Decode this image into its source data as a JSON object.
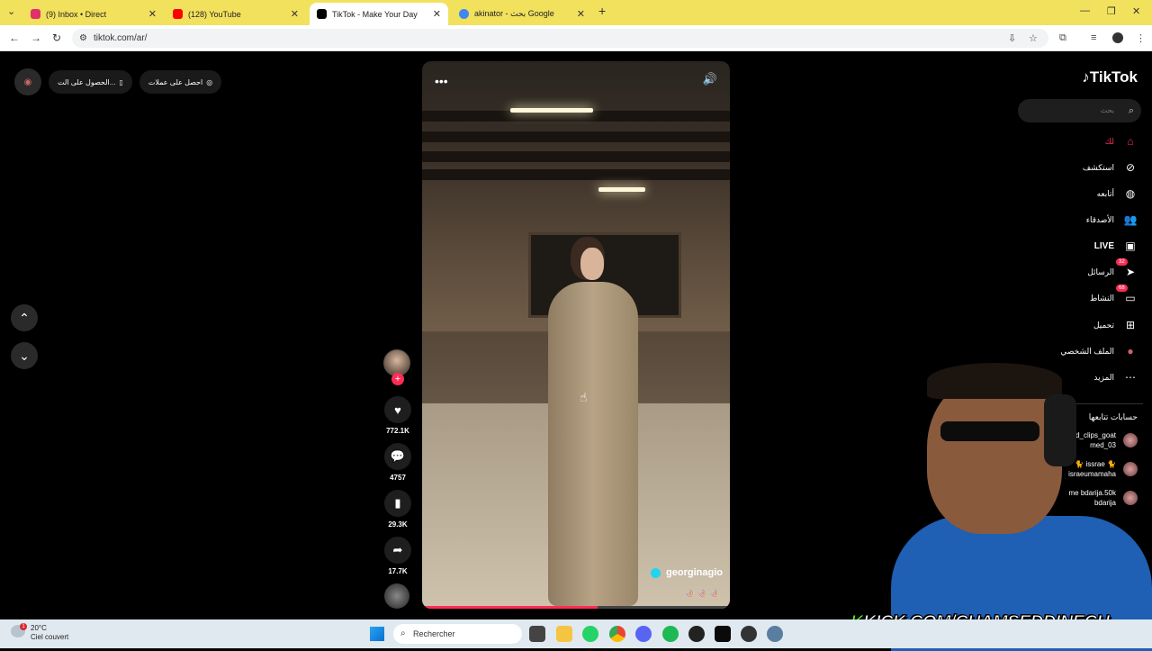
{
  "browser": {
    "tabs": [
      {
        "title": "(9) Inbox • Direct",
        "icon": "instagram-icon",
        "color": "#e1306c"
      },
      {
        "title": "(128) YouTube",
        "icon": "youtube-icon",
        "color": "#ff0000"
      },
      {
        "title": "TikTok - Make Your Day",
        "icon": "tiktok-icon",
        "color": "#000000"
      },
      {
        "title": "akinator - بحث Google",
        "icon": "google-icon",
        "color": "#4285f4"
      }
    ],
    "url": "tiktok.com/ar/"
  },
  "topbar": {
    "get_coins": "احصل على عملات",
    "get_app": "الحصول على الت..."
  },
  "video": {
    "author": "georginagio",
    "music": "🍭 🍭 🍭",
    "progress": 0.57
  },
  "actions": {
    "likes": "772.1K",
    "comments": "4757",
    "saves": "29.3K",
    "shares": "17.7K"
  },
  "sidebar": {
    "logo": "TikTok",
    "search_placeholder": "بحث",
    "items": [
      {
        "label": "لك",
        "icon": "home-icon",
        "badge": ""
      },
      {
        "label": "استكشف",
        "icon": "compass-icon",
        "badge": ""
      },
      {
        "label": "أتابعه",
        "icon": "following-icon",
        "badge": ""
      },
      {
        "label": "الأصدقاء",
        "icon": "friends-icon",
        "badge": ""
      },
      {
        "label": "LIVE",
        "icon": "live-icon",
        "badge": ""
      },
      {
        "label": "الرسائل",
        "icon": "messages-icon",
        "badge": "32"
      },
      {
        "label": "النشاط",
        "icon": "activity-icon",
        "badge": "68"
      },
      {
        "label": "تحميل",
        "icon": "upload-icon",
        "badge": ""
      },
      {
        "label": "الملف الشخصي",
        "icon": "profile-icon",
        "badge": ""
      },
      {
        "label": "المزيد",
        "icon": "more-icon",
        "badge": ""
      }
    ],
    "following_title": "حسابات تتابعها",
    "accounts": [
      {
        "line1": "dd_clips_goat",
        "line2": "med_03"
      },
      {
        "line1": "🐈 issrae 🐈",
        "line2": "israeumamaha"
      },
      {
        "line1": "me bdarija.50k",
        "line2": "bdarija"
      }
    ]
  },
  "overlay": {
    "kick_prefix": "K",
    "kick_text": "KICK.COM/CHAMSEDDINECH"
  },
  "taskbar": {
    "temperature": "20°C",
    "condition": "Ciel couvert",
    "search_label": "Rechercher",
    "weather_badge": "1"
  }
}
